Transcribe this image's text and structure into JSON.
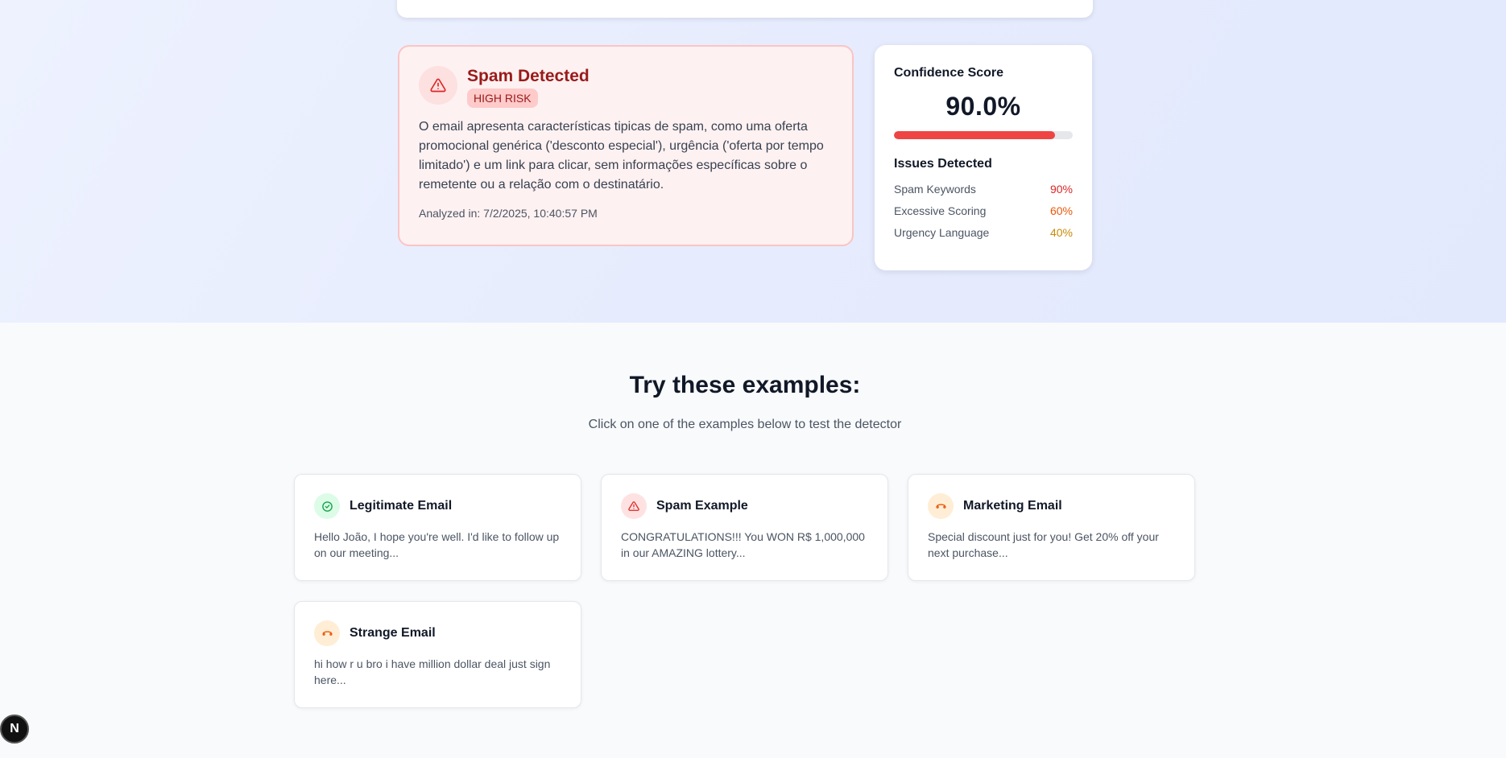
{
  "result": {
    "title": "Spam Detected",
    "risk_badge": "HIGH RISK",
    "description": "O email apresenta características tipicas de spam, como uma oferta promocional genérica ('desconto especial'), urgência ('oferta por tempo limitado') e um link para clicar, sem informações específicas sobre o remetente ou a relação com o destinatário.",
    "analyzed": "Analyzed in: 7/2/2025, 10:40:57 PM",
    "icon": "warning-triangle-icon"
  },
  "confidence": {
    "title": "Confidence Score",
    "value": "90.0%",
    "progress_fraction": 0.9,
    "bar_color": "#ef4444",
    "issues_title": "Issues Detected",
    "issues": [
      {
        "label": "Spam Keywords",
        "value": "90%",
        "color": "#dc2626"
      },
      {
        "label": "Excessive Scoring",
        "value": "60%",
        "color": "#ea580c"
      },
      {
        "label": "Urgency Language",
        "value": "40%",
        "color": "#ca8a04"
      }
    ]
  },
  "examples": {
    "title": "Try these examples:",
    "subtitle": "Click on one of the examples below to test the detector",
    "items": [
      {
        "title": "Legitimate Email",
        "text": "Hello João, I hope you're well. I'd like to follow up on our meeting...",
        "icon": "check-circle-icon",
        "icon_bg": "#dcfce7",
        "icon_color": "#16a34a"
      },
      {
        "title": "Spam Example",
        "text": "CONGRATULATIONS!!! You WON R$ 1,000,000 in our AMAZING lottery...",
        "icon": "warning-triangle-icon",
        "icon_bg": "#fee2e2",
        "icon_color": "#dc2626"
      },
      {
        "title": "Marketing Email",
        "text": "Special discount just for you! Get 20% off your next purchase...",
        "icon": "phone-icon",
        "icon_bg": "#ffedd5",
        "icon_color": "#ea580c"
      },
      {
        "title": "Strange Email",
        "text": "hi how r u bro i have million dollar deal just sign here...",
        "icon": "phone-icon",
        "icon_bg": "#ffedd5",
        "icon_color": "#ea580c"
      }
    ]
  },
  "dev_badge": {
    "label": "N"
  },
  "colors": {
    "spam_red": "#991b1b",
    "hero_bg": "#e6ecfd"
  }
}
